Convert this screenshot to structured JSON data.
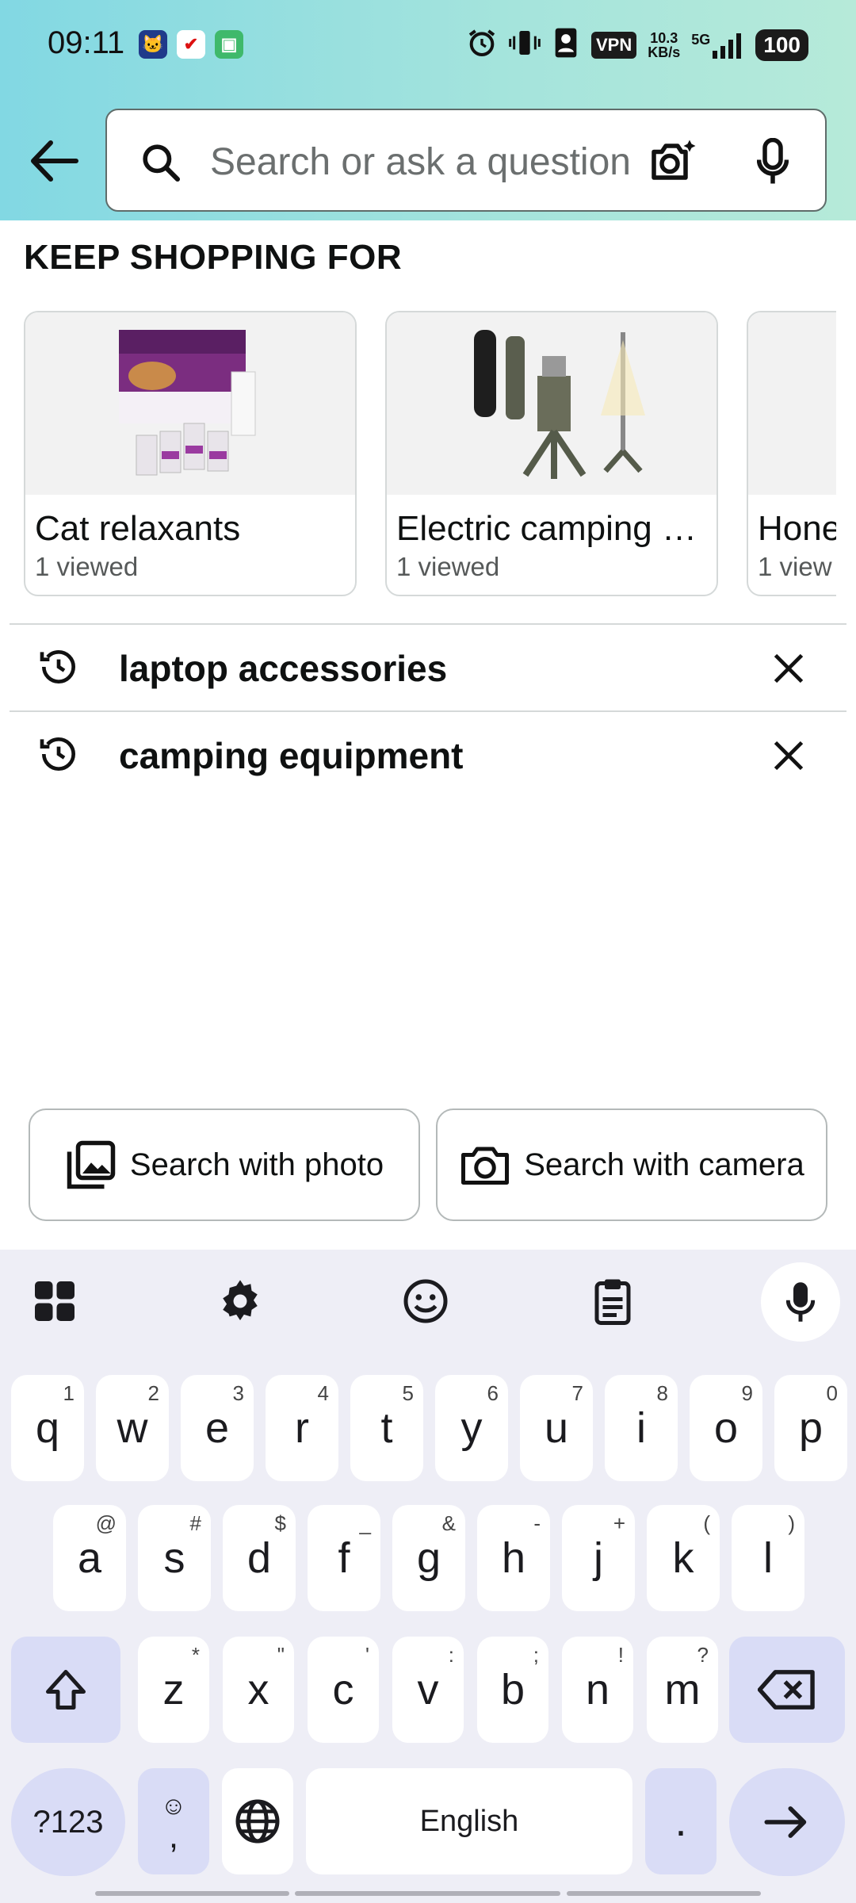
{
  "status_bar": {
    "time": "09:11",
    "vpn": "VPN",
    "speed_top": "10.3",
    "speed_bottom": "KB/s",
    "network": "5G",
    "battery": "100"
  },
  "search": {
    "placeholder": "Search or ask a question"
  },
  "keep_shopping": {
    "title": "KEEP SHOPPING FOR",
    "cards": [
      {
        "title": "Cat relaxants",
        "sub": "1 viewed"
      },
      {
        "title": "Electric camping …",
        "sub": "1 viewed"
      },
      {
        "title": "Hone",
        "sub": "1 view"
      }
    ]
  },
  "history": [
    {
      "text": "laptop accessories"
    },
    {
      "text": "camping equipment"
    }
  ],
  "actions": {
    "photo": "Search with photo",
    "camera": "Search with camera"
  },
  "keyboard": {
    "row1": [
      {
        "k": "q",
        "s": "1"
      },
      {
        "k": "w",
        "s": "2"
      },
      {
        "k": "e",
        "s": "3"
      },
      {
        "k": "r",
        "s": "4"
      },
      {
        "k": "t",
        "s": "5"
      },
      {
        "k": "y",
        "s": "6"
      },
      {
        "k": "u",
        "s": "7"
      },
      {
        "k": "i",
        "s": "8"
      },
      {
        "k": "o",
        "s": "9"
      },
      {
        "k": "p",
        "s": "0"
      }
    ],
    "row2": [
      {
        "k": "a",
        "s": "@"
      },
      {
        "k": "s",
        "s": "#"
      },
      {
        "k": "d",
        "s": "$"
      },
      {
        "k": "f",
        "s": "_"
      },
      {
        "k": "g",
        "s": "&"
      },
      {
        "k": "h",
        "s": "-"
      },
      {
        "k": "j",
        "s": "+"
      },
      {
        "k": "k",
        "s": "("
      },
      {
        "k": "l",
        "s": ")"
      }
    ],
    "row3": [
      {
        "k": "z",
        "s": "*"
      },
      {
        "k": "x",
        "s": "\""
      },
      {
        "k": "c",
        "s": "'"
      },
      {
        "k": "v",
        "s": ":"
      },
      {
        "k": "b",
        "s": ";"
      },
      {
        "k": "n",
        "s": "!"
      },
      {
        "k": "m",
        "s": "?"
      }
    ],
    "symbols": "?123",
    "comma": ",",
    "space": "English",
    "period": "."
  }
}
